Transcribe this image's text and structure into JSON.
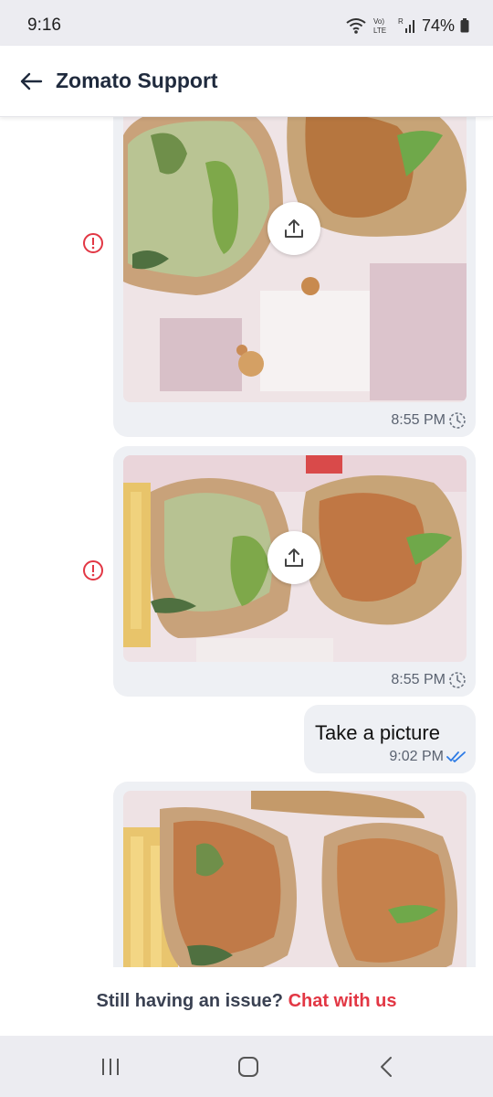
{
  "status_bar": {
    "time": "9:16",
    "network_label": "Vo) LTE",
    "roaming_label": "R",
    "battery": "74%"
  },
  "header": {
    "back_icon": "arrow-left-icon",
    "title": "Zomato Support"
  },
  "messages": [
    {
      "type": "image",
      "sender": "user",
      "time": "8:55 PM",
      "status_icon": "pending-clock-icon",
      "error": true,
      "upload_icon": "upload-icon"
    },
    {
      "type": "image",
      "sender": "user",
      "time": "8:55 PM",
      "status_icon": "pending-clock-icon",
      "error": true,
      "upload_icon": "upload-icon"
    },
    {
      "type": "text",
      "sender": "user",
      "text": "Take a picture",
      "time": "9:02 PM",
      "status_icon": "double-check-icon"
    },
    {
      "type": "image",
      "sender": "user"
    }
  ],
  "footer": {
    "question": "Still having an issue? ",
    "link": "Chat with us"
  },
  "colors": {
    "accent": "#e23744",
    "bubble": "#eef0f4",
    "read_tick": "#2d7be5",
    "error": "#e23744"
  },
  "nav_bar": {
    "recents_icon": "recent-apps-icon",
    "home_icon": "home-icon",
    "back_icon": "back-chevron-icon"
  }
}
